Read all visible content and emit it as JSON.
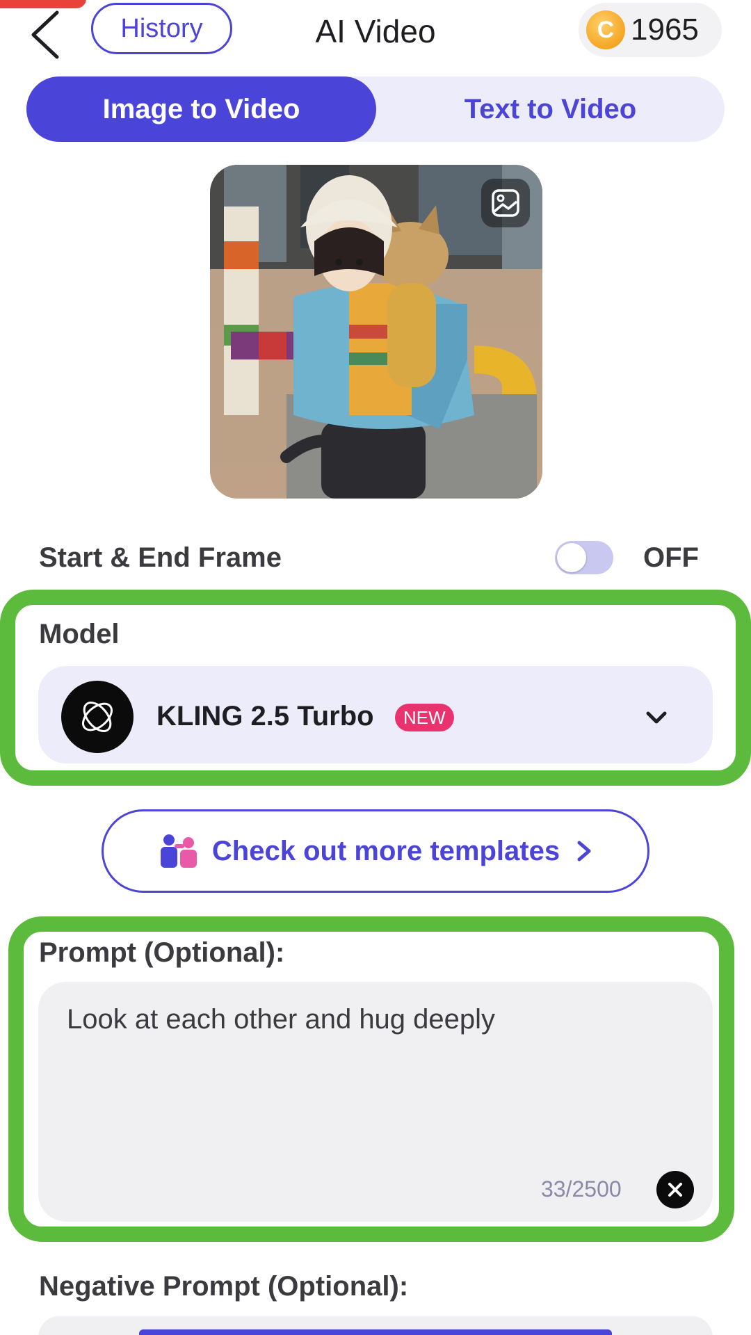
{
  "header": {
    "history_label": "History",
    "title": "AI Video",
    "coin_symbol": "C",
    "coin_count": "1965"
  },
  "mode_tabs": [
    {
      "label": "Image to Video",
      "active": true
    },
    {
      "label": "Text to Video",
      "active": false
    }
  ],
  "start_end_frame": {
    "label": "Start & End Frame",
    "state": "OFF"
  },
  "model": {
    "label": "Model",
    "name": "KLING 2.5 Turbo",
    "badge": "NEW"
  },
  "templates": {
    "label": "Check out more templates"
  },
  "prompt": {
    "label": "Prompt (Optional):",
    "value": "Look at each other and hug deeply",
    "counter": "33/2500"
  },
  "negative_prompt": {
    "label": "Negative Prompt (Optional):"
  },
  "colors": {
    "accent": "#4a44d9",
    "highlight": "#5cbb3c",
    "new_badge": "#e8336e",
    "coin": "#f5a623"
  }
}
